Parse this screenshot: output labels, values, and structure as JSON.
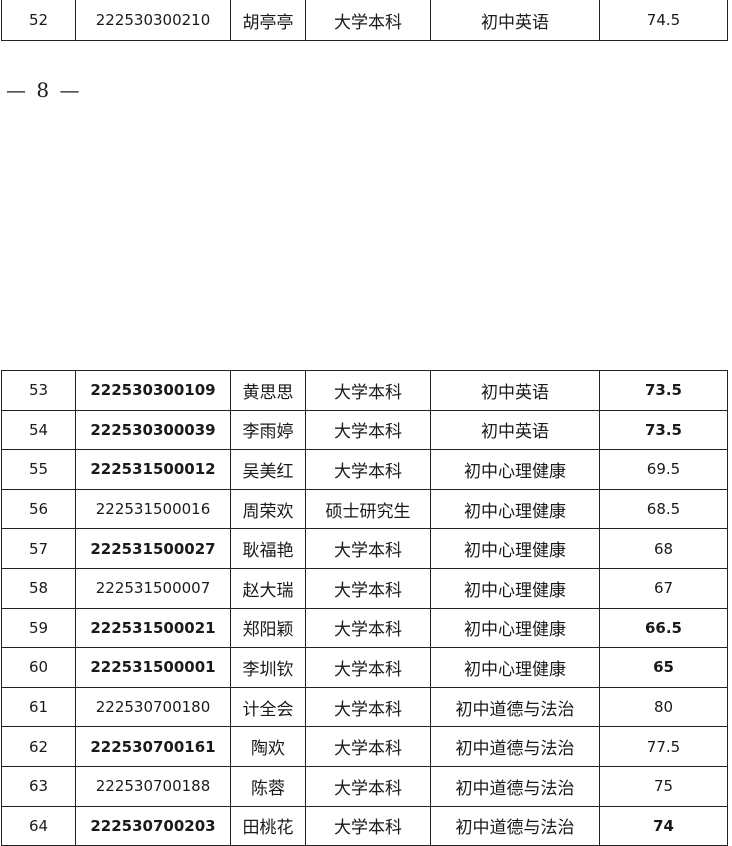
{
  "top_table": {
    "rows": [
      {
        "no": "52",
        "id": "222530300210",
        "name": "胡亭亭",
        "education": "大学本科",
        "subject": "初中英语",
        "score": "74.5"
      }
    ]
  },
  "page_number": "— 8 —",
  "main_table": {
    "rows": [
      {
        "no": "53",
        "id": "222530300109",
        "name": "黄思思",
        "education": "大学本科",
        "subject": "初中英语",
        "score": "73.5"
      },
      {
        "no": "54",
        "id": "222530300039",
        "name": "李雨婷",
        "education": "大学本科",
        "subject": "初中英语",
        "score": "73.5"
      },
      {
        "no": "55",
        "id": "222531500012",
        "name": "吴美红",
        "education": "大学本科",
        "subject": "初中心理健康",
        "score": "69.5"
      },
      {
        "no": "56",
        "id": "222531500016",
        "name": "周荣欢",
        "education": "硕士研究生",
        "subject": "初中心理健康",
        "score": "68.5"
      },
      {
        "no": "57",
        "id": "222531500027",
        "name": "耿福艳",
        "education": "大学本科",
        "subject": "初中心理健康",
        "score": "68"
      },
      {
        "no": "58",
        "id": "222531500007",
        "name": "赵大瑞",
        "education": "大学本科",
        "subject": "初中心理健康",
        "score": "67"
      },
      {
        "no": "59",
        "id": "222531500021",
        "name": "郑阳颖",
        "education": "大学本科",
        "subject": "初中心理健康",
        "score": "66.5"
      },
      {
        "no": "60",
        "id": "222531500001",
        "name": "李圳钦",
        "education": "大学本科",
        "subject": "初中心理健康",
        "score": "65"
      },
      {
        "no": "61",
        "id": "222530700180",
        "name": "计全会",
        "education": "大学本科",
        "subject": "初中道德与法治",
        "score": "80"
      },
      {
        "no": "62",
        "id": "222530700161",
        "name": "陶欢",
        "education": "大学本科",
        "subject": "初中道德与法治",
        "score": "77.5"
      },
      {
        "no": "63",
        "id": "222530700188",
        "name": "陈蓉",
        "education": "大学本科",
        "subject": "初中道德与法治",
        "score": "75"
      },
      {
        "no": "64",
        "id": "222530700203",
        "name": "田桃花",
        "education": "大学本科",
        "subject": "初中道德与法治",
        "score": "74"
      }
    ]
  }
}
